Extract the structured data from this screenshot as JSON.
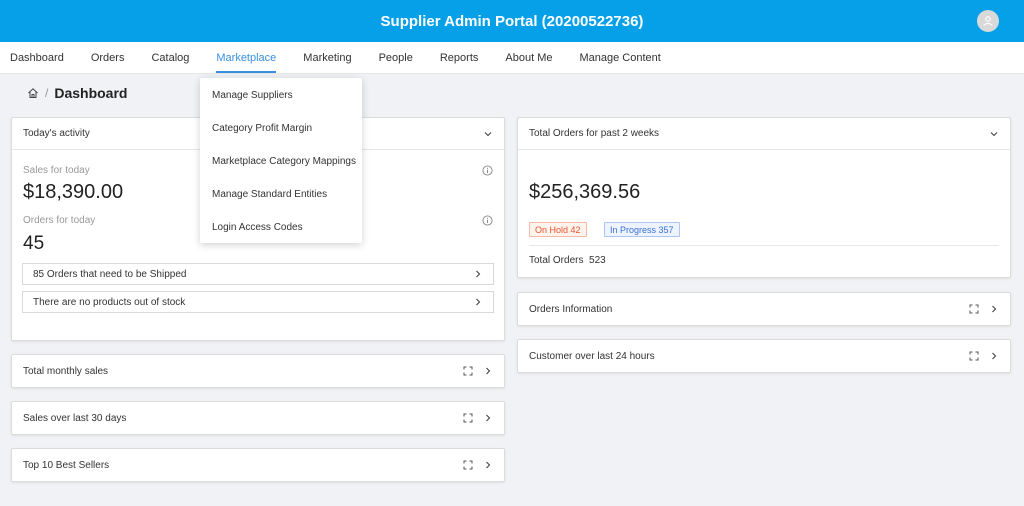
{
  "header": {
    "title": "Supplier Admin Portal (20200522736)",
    "avatar_icon": "user-icon"
  },
  "nav": {
    "items": [
      {
        "label": "Dashboard"
      },
      {
        "label": "Orders"
      },
      {
        "label": "Catalog"
      },
      {
        "label": "Marketplace",
        "active": true
      },
      {
        "label": "Marketing"
      },
      {
        "label": "People"
      },
      {
        "label": "Reports"
      },
      {
        "label": "About Me"
      },
      {
        "label": "Manage Content"
      }
    ]
  },
  "breadcrumb": {
    "separator": "/",
    "page_title": "Dashboard"
  },
  "marketplace_menu": {
    "items": [
      "Manage Suppliers",
      "Category Profit Margin",
      "Marketplace Category Mappings",
      "Manage Standard Entities",
      "Login Access Codes"
    ]
  },
  "todays_activity": {
    "title": "Today's activity",
    "sales_label": "Sales for today",
    "sales_value": "$18,390.00",
    "orders_label": "Orders for today",
    "orders_value": "45",
    "rows": [
      "85 Orders that need to be Shipped",
      "There are no products out of stock"
    ]
  },
  "collapsed_left": [
    "Total monthly sales",
    "Sales over last 30 days",
    "Top 10 Best Sellers"
  ],
  "total_orders": {
    "title": "Total Orders for past 2 weeks",
    "amount": "$256,369.56",
    "on_hold": "On Hold 42",
    "in_progress": "In Progress 357",
    "total_label": "Total Orders",
    "total_value": "523"
  },
  "collapsed_right": [
    "Orders Information",
    "Customer over last 24 hours"
  ],
  "colors": {
    "header_bg": "#06a0e8",
    "accent": "#3b8fe0",
    "hold": "#e8542c",
    "progress": "#3b6fd6"
  }
}
